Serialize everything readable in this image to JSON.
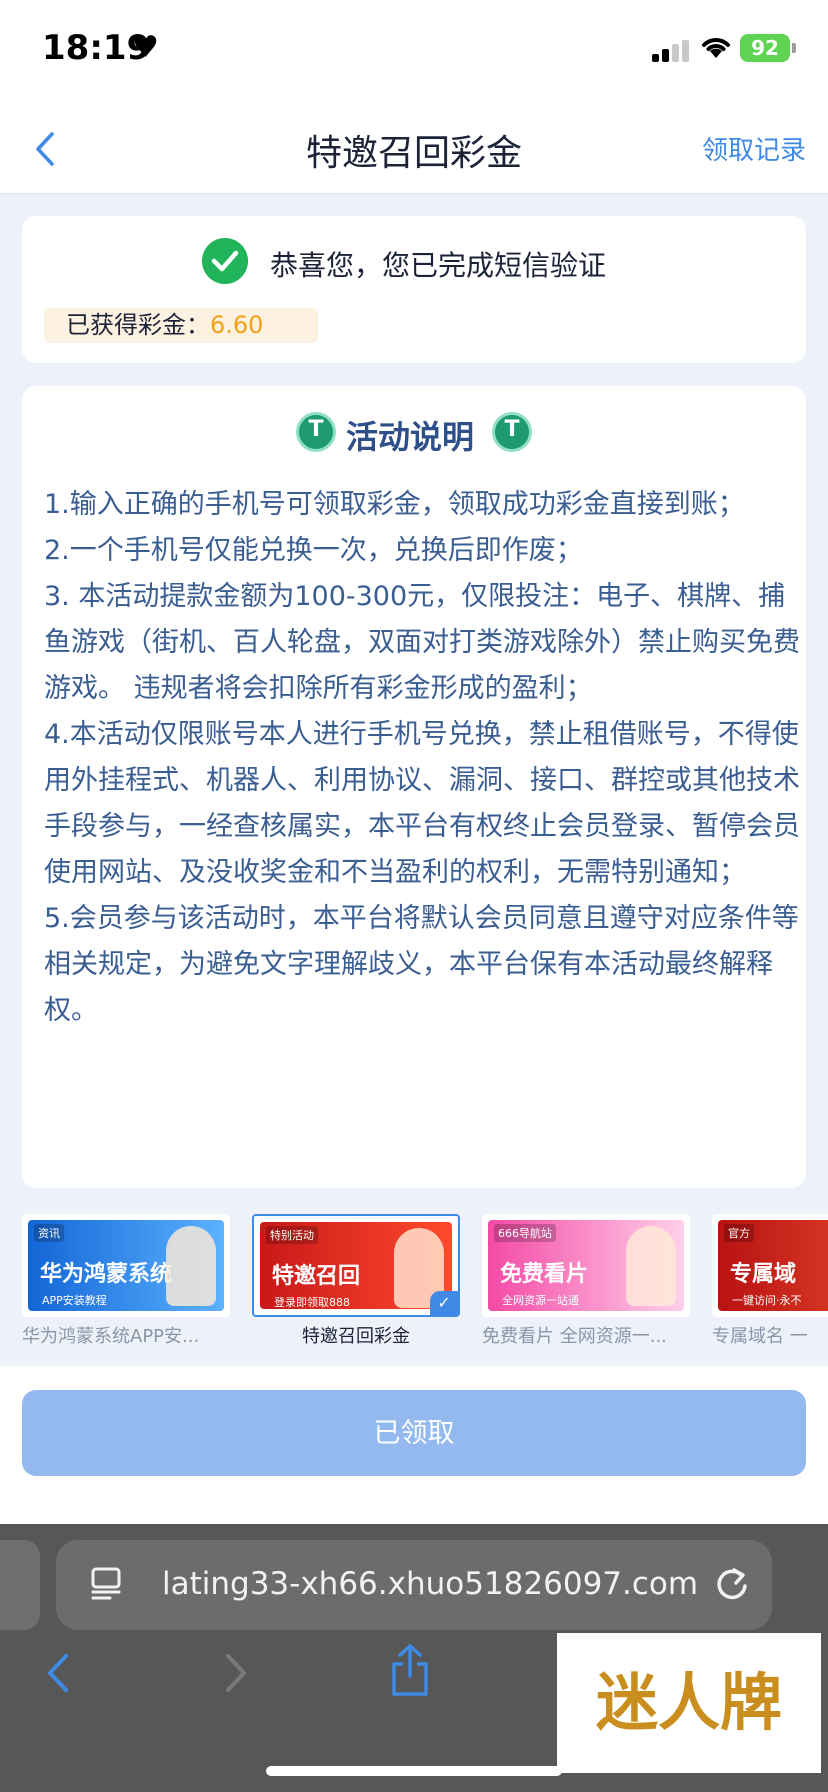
{
  "status_bar": {
    "time": "18:19",
    "battery": "92"
  },
  "nav": {
    "title": "特邀召回彩金",
    "right_link": "领取记录"
  },
  "verification": {
    "message": "恭喜您，您已完成短信验证",
    "reward_label": "已获得彩金：",
    "reward_value": "6.60"
  },
  "rules": {
    "title": "活动说明",
    "items": [
      "1.输入正确的手机号可领取彩金，领取成功彩金直接到账；",
      "2.一个手机号仅能兑换一次，兑换后即作废；",
      "3. 本活动提款金额为100-300元，仅限投注：电子、棋牌、捕鱼游戏（街机、百人轮盘，双面对打类游戏除外）禁止购买免费游戏。 违规者将会扣除所有彩金形成的盈利；",
      "4.本活动仅限账号本人进行手机号兑换，禁止租借账号，不得使用外挂程式、机器人、利用协议、漏洞、接口、群控或其他技术手段参与，一经查核属实，本平台有权终止会员登录、暂停会员使用网站、及没收奖金和不当盈利的权利，无需特别通知；",
      "5.会员参与该活动时，本平台将默认会员同意且遵守对应条件等相关规定，为避免文字理解歧义，本平台保有本活动最终解释权。"
    ]
  },
  "banners": [
    {
      "tag": "资讯",
      "title": "华为鸿蒙系统",
      "subtitle": "APP安装教程",
      "label": "华为鸿蒙系统APP安..."
    },
    {
      "tag": "特别活动",
      "title": "特邀召回",
      "subtitle": "登录即领取888",
      "label": "特邀召回彩金"
    },
    {
      "tag": "666导航站",
      "title": "免费看片",
      "subtitle": "全网资源一站通",
      "label": "免费看片 全网资源一..."
    },
    {
      "tag": "官方",
      "title": "专属域",
      "subtitle": "一键访问·永不",
      "label": "专属域名 一"
    }
  ],
  "claim_button": "已领取",
  "browser": {
    "url": "lating33-xh66.xhuo51826097.com"
  },
  "watermark": "迷人牌"
}
